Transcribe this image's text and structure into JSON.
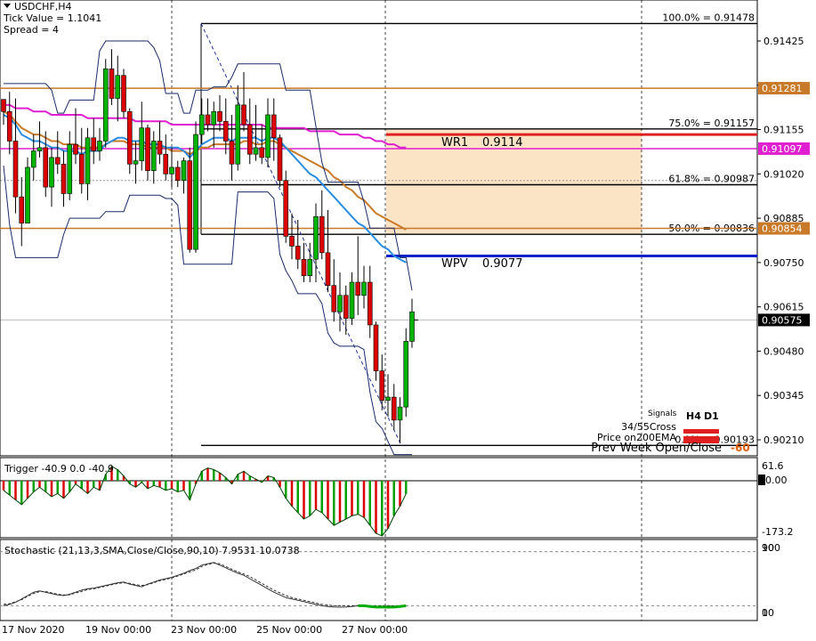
{
  "header": {
    "symbol_line": "USDCHF,H4",
    "tick_value": "Tick Value = 1.1041",
    "spread": "Spread = 4"
  },
  "colors": {
    "bull": "#00b400",
    "bear": "#dd0000",
    "ema_brown": "#c87a28",
    "ma_magenta": "#e020d0",
    "ma_blue": "#2a8ce0",
    "pivot_blue": "#0020c8",
    "wr1_red": "#e02020",
    "zone": "#fbe3c6"
  },
  "price_axis": {
    "ticks": [
      "0.91425",
      "0.91290",
      "0.91155",
      "0.91020",
      "0.90885",
      "0.90750",
      "0.90615",
      "0.90480",
      "0.90345",
      "0.90210"
    ],
    "tagged_levels": [
      {
        "label": "0.91281",
        "value": 0.91281,
        "color": "#c87a28"
      },
      {
        "label": "0.91097",
        "value": 0.91097,
        "color": "#e020d0"
      },
      {
        "label": "0.90854",
        "value": 0.90854,
        "color": "#c87a28"
      },
      {
        "label": "0.90575",
        "value": 0.90575,
        "color": "#000000"
      }
    ]
  },
  "time_axis": {
    "labels": [
      "17 Nov 2020",
      "19 Nov 00:00",
      "23 Nov 00:00",
      "25 Nov 00:00",
      "27 Nov 00:00"
    ]
  },
  "fibonacci": [
    {
      "label": "100.0% = 0.91478",
      "value": 0.91478
    },
    {
      "label": "75.0% = 0.91157",
      "value": 0.91157
    },
    {
      "label": "61.8% = 0.90987",
      "value": 0.90987
    },
    {
      "label": "50.0% = 0.90836",
      "value": 0.90836
    },
    {
      "label": "0.0% = 0.90193",
      "value": 0.90193
    }
  ],
  "pivots": {
    "wr1_name": "WR1",
    "wr1_value": "0.9114",
    "wpv_name": "WPV",
    "wpv_value": "0.9077"
  },
  "signals": {
    "title": "Signals",
    "h4": "H4",
    "d1": "D1",
    "row1": "34/55Cross",
    "row2": "Price on200EMA",
    "row3": "Prev Week Open/Close",
    "row3_value": "-60"
  },
  "trigger_panel": {
    "title": "Trigger -40.9 0.0 -40.9",
    "ticks": [
      "61.6",
      "0.00",
      "-173.2"
    ],
    "value": -40.9
  },
  "stoch_panel": {
    "title": "Stochastic (21,13,3,SMA,Close/Close,90,10) 7.9531 10.0738",
    "ticks": [
      "100",
      "90",
      "10",
      "0"
    ],
    "main": 7.9531,
    "signal": 10.0738
  },
  "chart_data": {
    "type": "candlestick",
    "symbol": "USDCHF",
    "timeframe": "H4",
    "x_labels": [
      "17 Nov 2020",
      "19 Nov 00:00",
      "23 Nov 00:00",
      "25 Nov 00:00",
      "27 Nov 00:00"
    ],
    "ylim": [
      0.9015,
      0.9148
    ],
    "last_price": 0.90575,
    "candles": [
      [
        0.91247,
        0.91247,
        0.9117,
        0.9121
      ],
      [
        0.9121,
        0.9127,
        0.9108,
        0.9112
      ],
      [
        0.9112,
        0.9125,
        0.909,
        0.9095
      ],
      [
        0.9095,
        0.9101,
        0.908,
        0.9087
      ],
      [
        0.9087,
        0.9107,
        0.9087,
        0.9104
      ],
      [
        0.9104,
        0.9114,
        0.91,
        0.9109
      ],
      [
        0.9109,
        0.9118,
        0.9107,
        0.911
      ],
      [
        0.911,
        0.9115,
        0.9095,
        0.9098
      ],
      [
        0.9098,
        0.911,
        0.9092,
        0.9107
      ],
      [
        0.9107,
        0.9115,
        0.9102,
        0.9105
      ],
      [
        0.9105,
        0.9109,
        0.9092,
        0.9096
      ],
      [
        0.9096,
        0.9115,
        0.9094,
        0.9111
      ],
      [
        0.9111,
        0.9122,
        0.9105,
        0.9108
      ],
      [
        0.9108,
        0.9116,
        0.9096,
        0.9099
      ],
      [
        0.9099,
        0.9116,
        0.9094,
        0.9113
      ],
      [
        0.9113,
        0.9119,
        0.9105,
        0.9109
      ],
      [
        0.9109,
        0.9116,
        0.9106,
        0.9112
      ],
      [
        0.9112,
        0.9137,
        0.911,
        0.9134
      ],
      [
        0.9134,
        0.914,
        0.9123,
        0.9125
      ],
      [
        0.9125,
        0.9138,
        0.9118,
        0.9132
      ],
      [
        0.9132,
        0.9134,
        0.9119,
        0.9121
      ],
      [
        0.9121,
        0.9122,
        0.9102,
        0.9105
      ],
      [
        0.9105,
        0.9112,
        0.9099,
        0.9106
      ],
      [
        0.9106,
        0.9124,
        0.9103,
        0.9116
      ],
      [
        0.9116,
        0.9117,
        0.91,
        0.9103
      ],
      [
        0.9103,
        0.9115,
        0.9099,
        0.9112
      ],
      [
        0.9112,
        0.9118,
        0.9105,
        0.9108
      ],
      [
        0.9108,
        0.9114,
        0.91,
        0.9102
      ],
      [
        0.9102,
        0.911,
        0.9098,
        0.9104
      ],
      [
        0.9104,
        0.9106,
        0.9098,
        0.91
      ],
      [
        0.91,
        0.9107,
        0.9096,
        0.9106
      ],
      [
        0.9106,
        0.911,
        0.9078,
        0.9079
      ],
      [
        0.9079,
        0.9118,
        0.9078,
        0.9114
      ],
      [
        0.9114,
        0.9125,
        0.9111,
        0.912
      ],
      [
        0.912,
        0.9125,
        0.9115,
        0.9117
      ],
      [
        0.9117,
        0.9124,
        0.911,
        0.9121
      ],
      [
        0.9121,
        0.9126,
        0.9115,
        0.9118
      ],
      [
        0.9118,
        0.9125,
        0.9108,
        0.9112
      ],
      [
        0.9112,
        0.912,
        0.91,
        0.9105
      ],
      [
        0.9105,
        0.9129,
        0.9103,
        0.9123
      ],
      [
        0.9123,
        0.9133,
        0.9115,
        0.9117
      ],
      [
        0.9117,
        0.9125,
        0.9105,
        0.9108
      ],
      [
        0.9108,
        0.9123,
        0.9106,
        0.911
      ],
      [
        0.911,
        0.9117,
        0.9105,
        0.9107
      ],
      [
        0.9107,
        0.9125,
        0.9104,
        0.912
      ],
      [
        0.912,
        0.9125,
        0.9106,
        0.9113
      ],
      [
        0.9113,
        0.9114,
        0.9098,
        0.91
      ],
      [
        0.91,
        0.9103,
        0.9081,
        0.9083
      ],
      [
        0.9083,
        0.909,
        0.9076,
        0.908
      ],
      [
        0.908,
        0.9088,
        0.9073,
        0.9076
      ],
      [
        0.9076,
        0.9081,
        0.9069,
        0.9071
      ],
      [
        0.9071,
        0.9081,
        0.9069,
        0.9076
      ],
      [
        0.9076,
        0.9093,
        0.9069,
        0.9089
      ],
      [
        0.9089,
        0.9097,
        0.9076,
        0.9078
      ],
      [
        0.9078,
        0.9091,
        0.9066,
        0.9068
      ],
      [
        0.9068,
        0.9076,
        0.9057,
        0.906
      ],
      [
        0.906,
        0.9072,
        0.9054,
        0.9065
      ],
      [
        0.9065,
        0.9068,
        0.9053,
        0.9058
      ],
      [
        0.9058,
        0.9072,
        0.9056,
        0.9069
      ],
      [
        0.9069,
        0.9083,
        0.9059,
        0.9065
      ],
      [
        0.9065,
        0.9074,
        0.9061,
        0.9069
      ],
      [
        0.9069,
        0.9074,
        0.9052,
        0.9056
      ],
      [
        0.9056,
        0.9057,
        0.9039,
        0.9042
      ],
      [
        0.9042,
        0.9047,
        0.903,
        0.9033
      ],
      [
        0.9033,
        0.9041,
        0.9028,
        0.9034
      ],
      [
        0.9034,
        0.9038,
        0.9024,
        0.9027
      ],
      [
        0.9027,
        0.9034,
        0.902,
        0.9031
      ],
      [
        0.9031,
        0.9055,
        0.9028,
        0.9051
      ],
      [
        0.9051,
        0.9064,
        0.9049,
        0.906
      ]
    ],
    "ema_brown": [
      0.9121,
      0.912,
      0.9118,
      0.9116,
      0.9115,
      0.9114,
      0.9114,
      0.9113,
      0.9112,
      0.9112,
      0.9111,
      0.9111,
      0.9111,
      0.911,
      0.911,
      0.911,
      0.911,
      0.9111,
      0.9112,
      0.9112,
      0.9112,
      0.9111,
      0.9111,
      0.9111,
      0.911,
      0.911,
      0.911,
      0.911,
      0.9109,
      0.9109,
      0.9109,
      0.9108,
      0.9109,
      0.911,
      0.911,
      0.9111,
      0.9111,
      0.9111,
      0.9111,
      0.9111,
      0.9112,
      0.9112,
      0.9111,
      0.9111,
      0.9112,
      0.9112,
      0.9111,
      0.911,
      0.9109,
      0.9108,
      0.9107,
      0.9106,
      0.9105,
      0.9104,
      0.9103,
      0.9101,
      0.91,
      0.9098,
      0.9097,
      0.9095,
      0.9094,
      0.9092,
      0.909,
      0.9089,
      0.9088,
      0.9087,
      0.9086,
      0.9085
    ],
    "ma_magenta": [
      0.9123,
      0.9123,
      0.9122,
      0.9122,
      0.9122,
      0.9121,
      0.9121,
      0.9121,
      0.912,
      0.912,
      0.912,
      0.912,
      0.912,
      0.912,
      0.9119,
      0.9119,
      0.9119,
      0.9119,
      0.9119,
      0.9119,
      0.9119,
      0.9119,
      0.9118,
      0.9118,
      0.9118,
      0.9118,
      0.9118,
      0.9118,
      0.9117,
      0.9117,
      0.9117,
      0.9117,
      0.9117,
      0.9117,
      0.9117,
      0.9117,
      0.9117,
      0.9117,
      0.9117,
      0.9117,
      0.9117,
      0.9117,
      0.9117,
      0.9117,
      0.9116,
      0.9116,
      0.9116,
      0.9116,
      0.9116,
      0.9116,
      0.9116,
      0.9115,
      0.9115,
      0.9115,
      0.9115,
      0.9115,
      0.9114,
      0.9114,
      0.9114,
      0.9114,
      0.9113,
      0.9113,
      0.9112,
      0.9112,
      0.9111,
      0.9111,
      0.911,
      0.911
    ],
    "ma_blue": [
      0.912,
      0.9119,
      0.9117,
      0.9114,
      0.9113,
      0.9112,
      0.9112,
      0.9111,
      0.911,
      0.911,
      0.9109,
      0.9109,
      0.9109,
      0.9108,
      0.9109,
      0.9109,
      0.9109,
      0.9111,
      0.9112,
      0.9113,
      0.9113,
      0.9112,
      0.9112,
      0.9112,
      0.9111,
      0.9111,
      0.9111,
      0.911,
      0.911,
      0.911,
      0.9109,
      0.9107,
      0.9109,
      0.9111,
      0.9112,
      0.9113,
      0.9113,
      0.9113,
      0.9112,
      0.9113,
      0.9113,
      0.9113,
      0.9113,
      0.9112,
      0.9113,
      0.9113,
      0.9112,
      0.911,
      0.9108,
      0.9106,
      0.9104,
      0.9102,
      0.9101,
      0.9099,
      0.9097,
      0.9095,
      0.9093,
      0.9091,
      0.9089,
      0.9087,
      0.9086,
      0.9084,
      0.9082,
      0.908,
      0.9079,
      0.9077,
      0.9076,
      0.9075
    ],
    "trigger": [
      -30,
      -45,
      -60,
      -75,
      -55,
      -35,
      -20,
      -35,
      -50,
      -40,
      -55,
      -35,
      -10,
      -25,
      -40,
      -20,
      -30,
      20,
      45,
      35,
      15,
      -10,
      -20,
      -5,
      -25,
      -15,
      -20,
      -30,
      -25,
      -35,
      -30,
      -60,
      -10,
      30,
      40,
      35,
      25,
      10,
      -10,
      20,
      30,
      15,
      5,
      -5,
      15,
      10,
      -20,
      -55,
      -80,
      -100,
      -120,
      -110,
      -90,
      -100,
      -120,
      -140,
      -130,
      -120,
      -110,
      -105,
      -115,
      -140,
      -165,
      -173,
      -150,
      -110,
      -80,
      -40.9
    ],
    "stoch_main": [
      10,
      12,
      15,
      20,
      25,
      30,
      32,
      30,
      28,
      26,
      25,
      27,
      30,
      33,
      35,
      36,
      38,
      40,
      42,
      44,
      45,
      42,
      40,
      38,
      42,
      45,
      48,
      50,
      52,
      55,
      58,
      62,
      65,
      70,
      72,
      74,
      70,
      66,
      62,
      58,
      55,
      50,
      45,
      40,
      35,
      30,
      26,
      22,
      20,
      18,
      16,
      14,
      12,
      10,
      9,
      8,
      7.9531,
      8,
      9,
      10,
      10,
      9,
      8,
      8,
      7.9531,
      8,
      9,
      10
    ],
    "stoch_signal": [
      12,
      13,
      16,
      19,
      24,
      28,
      31,
      31,
      29,
      27,
      26,
      26,
      29,
      31,
      34,
      35,
      37,
      39,
      41,
      43,
      44,
      43,
      41,
      40,
      41,
      44,
      47,
      49,
      51,
      54,
      57,
      60,
      63,
      68,
      71,
      73,
      72,
      68,
      64,
      60,
      57,
      53,
      48,
      43,
      38,
      33,
      29,
      25,
      22,
      20,
      18,
      16,
      14,
      12,
      11,
      10,
      10.0738,
      10,
      10,
      10,
      10,
      10,
      10,
      10,
      10.0738,
      10,
      10,
      10
    ]
  }
}
